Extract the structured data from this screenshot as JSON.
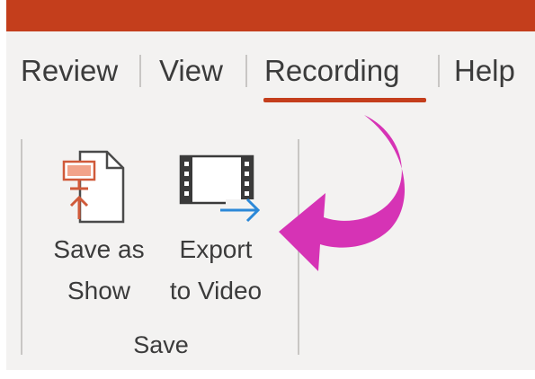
{
  "ribbon": {
    "tabs": [
      {
        "label": "Review",
        "active": false
      },
      {
        "label": "View",
        "active": false
      },
      {
        "label": "Recording",
        "active": true
      },
      {
        "label": "Help",
        "active": false
      }
    ],
    "group": {
      "label": "Save",
      "commands": [
        {
          "label_line1": "Save as",
          "label_line2": "Show",
          "icon": "save-as-show-icon"
        },
        {
          "label_line1": "Export",
          "label_line2": "to Video",
          "icon": "export-to-video-icon"
        }
      ]
    }
  },
  "annotation": {
    "icon": "curved-arrow-icon",
    "color": "#d633b5"
  },
  "colors": {
    "accent": "#c43e1c",
    "ribbon_bg": "#f3f2f1",
    "text": "#3b3b3b",
    "export_arrow": "#2b88d8"
  }
}
